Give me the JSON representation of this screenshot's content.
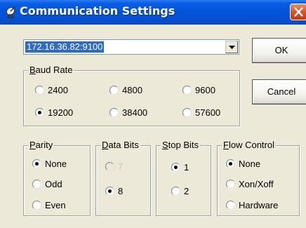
{
  "window": {
    "title": "Communication Settings",
    "icon": "satellite-dish-icon",
    "close_icon": "close-icon",
    "accent": "#0a5fe5",
    "close_color": "#d6542c"
  },
  "address": {
    "value": "172.16.36.82:9100",
    "dropdown_icon": "dropdown-arrow-icon"
  },
  "buttons": {
    "ok": "OK",
    "cancel": "Cancel"
  },
  "baud_rate": {
    "label_ul": "B",
    "label_rest": "aud Rate",
    "options": [
      {
        "label": "2400",
        "checked": false
      },
      {
        "label": "4800",
        "checked": false
      },
      {
        "label": "9600",
        "checked": false
      },
      {
        "label": "19200",
        "checked": true
      },
      {
        "label": "38400",
        "checked": false
      },
      {
        "label": "57600",
        "checked": false
      }
    ]
  },
  "parity": {
    "label_ul": "P",
    "label_rest": "arity",
    "options": [
      {
        "label": "None",
        "checked": true
      },
      {
        "label": "Odd",
        "checked": false
      },
      {
        "label": "Even",
        "checked": false
      }
    ]
  },
  "data_bits": {
    "label_ul": "D",
    "label_rest": "ata Bits",
    "options": [
      {
        "label": "7",
        "checked": false,
        "disabled": true
      },
      {
        "label": "8",
        "checked": true,
        "disabled": false
      }
    ]
  },
  "stop_bits": {
    "label_ul": "S",
    "label_rest": "top Bits",
    "options": [
      {
        "label": "1",
        "checked": true
      },
      {
        "label": "2",
        "checked": false
      }
    ]
  },
  "flow_control": {
    "label_ul": "F",
    "label_rest": "low Control",
    "options": [
      {
        "label": "None",
        "checked": true
      },
      {
        "label": "Xon/Xoff",
        "checked": false
      },
      {
        "label": "Hardware",
        "checked": false
      }
    ]
  }
}
